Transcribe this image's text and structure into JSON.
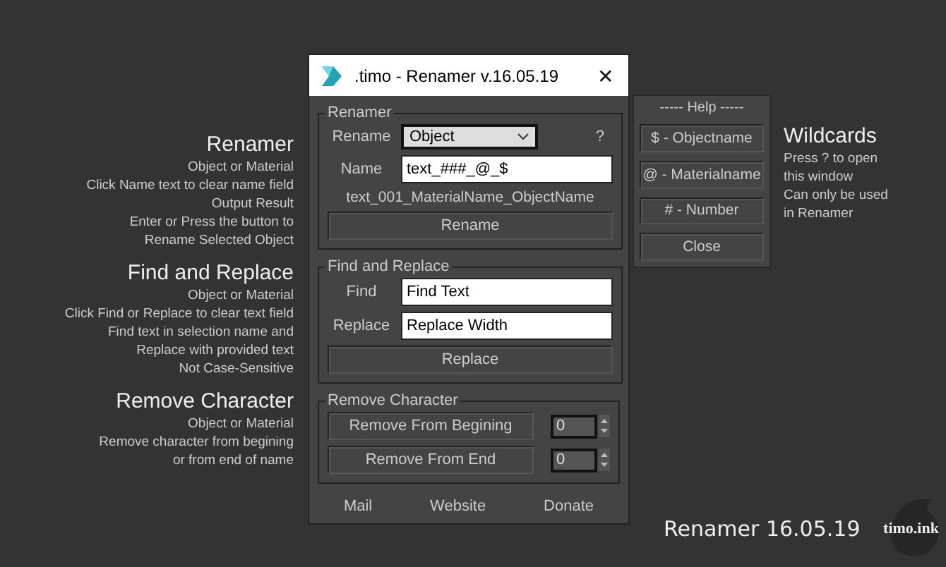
{
  "notes": [
    {
      "title": "Renamer",
      "lines": [
        "Object or Material",
        "Click Name text to clear name field",
        "Output Result",
        "Enter or Press the button to",
        "Rename Selected Object"
      ]
    },
    {
      "title": "Find and Replace",
      "lines": [
        "Object or Material",
        "Click Find or Replace to clear text field",
        "Find text in selection name and",
        "Replace with provided text",
        "Not Case-Sensitive"
      ]
    },
    {
      "title": "Remove Character",
      "lines": [
        "Object or Material",
        "Remove character from begining",
        "or from end of name"
      ]
    }
  ],
  "window": {
    "title": ".timo - Renamer v.16.05.19",
    "close": "✕"
  },
  "renamer": {
    "legend": "Renamer",
    "rename_label": "Rename",
    "rename_value": "Object",
    "help": "?",
    "name_label": "Name",
    "name_value": "text_###_@_$",
    "preview": "text_001_MaterialName_ObjectName",
    "button": "Rename"
  },
  "find_replace": {
    "legend": "Find and Replace",
    "find_label": "Find",
    "find_value": "Find Text",
    "replace_label": "Replace",
    "replace_value": "Replace Width",
    "button": "Replace"
  },
  "remove_character": {
    "legend": "Remove Character",
    "rows": [
      {
        "button": "Remove From Begining",
        "value": "0"
      },
      {
        "button": "Remove From End",
        "value": "0"
      }
    ]
  },
  "links": [
    "Mail",
    "Website",
    "Donate"
  ],
  "help": {
    "title": "----- Help -----",
    "buttons": [
      "$ - Objectname",
      "@ - Materialname",
      "# - Number",
      "Close"
    ]
  },
  "wildcards": {
    "title": "Wildcards",
    "lines": [
      "Press ? to open",
      "this window",
      "Can only be used",
      "in Renamer"
    ]
  },
  "brand": {
    "version": "Renamer 16.05.19",
    "logo": "timo.ink"
  }
}
